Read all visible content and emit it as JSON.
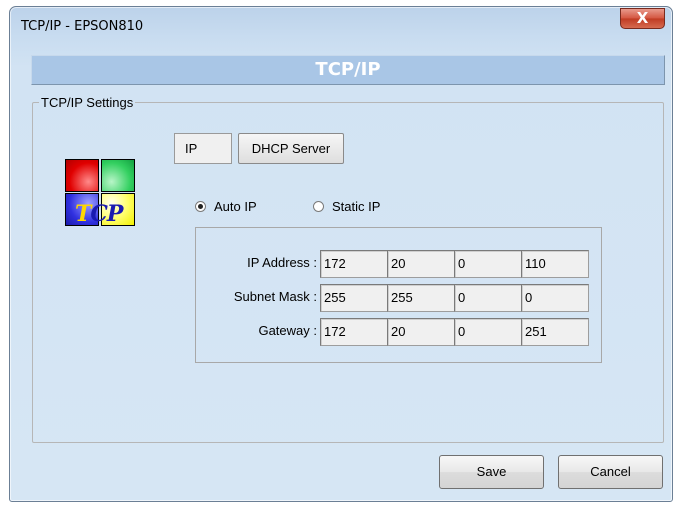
{
  "window": {
    "title": "TCP/IP - EPSON810",
    "close_glyph": "X"
  },
  "header": {
    "title": "TCP/IP"
  },
  "settings_group": {
    "legend": "TCP/IP Settings"
  },
  "logo": {
    "text_t": "T",
    "text_rest": "CP"
  },
  "tabs": [
    {
      "label": "IP"
    },
    {
      "label": "DHCP Server"
    }
  ],
  "mode": {
    "options": [
      {
        "label": "Auto IP",
        "checked": true
      },
      {
        "label": "Static IP",
        "checked": false
      }
    ]
  },
  "ip_config": {
    "rows": [
      {
        "label": "IP Address :",
        "octets": [
          "172",
          "20",
          "0",
          "110"
        ]
      },
      {
        "label": "Subnet Mask :",
        "octets": [
          "255",
          "255",
          "0",
          "0"
        ]
      },
      {
        "label": "Gateway :",
        "octets": [
          "172",
          "20",
          "0",
          "251"
        ]
      }
    ]
  },
  "buttons": {
    "save": "Save",
    "cancel": "Cancel"
  }
}
